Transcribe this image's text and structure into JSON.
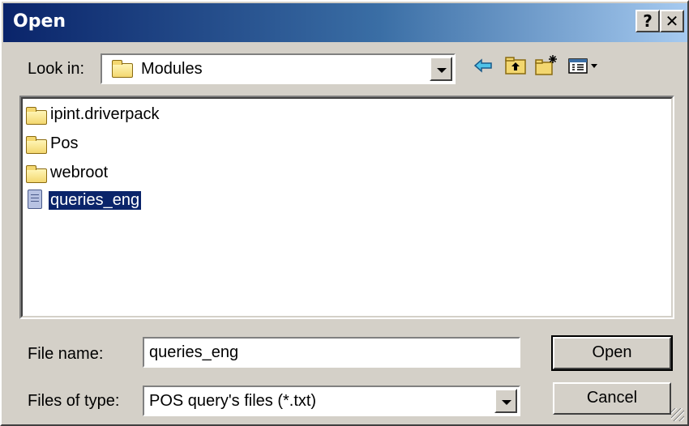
{
  "window": {
    "title": "Open",
    "help_label": "?",
    "close_label": "✕"
  },
  "look_in": {
    "label": "Look in:",
    "value": "Modules",
    "icon": "folder-icon"
  },
  "toolbar": {
    "back": "back-icon",
    "up_folder": "up-folder-icon",
    "new_folder": "new-folder-icon",
    "view_menu": "view-menu-icon"
  },
  "files": [
    {
      "name": "ipint.driverpack",
      "type": "folder",
      "selected": false
    },
    {
      "name": "Pos",
      "type": "folder",
      "selected": false
    },
    {
      "name": "webroot",
      "type": "folder",
      "selected": false
    },
    {
      "name": "queries_eng",
      "type": "file",
      "selected": true
    }
  ],
  "file_name": {
    "label": "File name:",
    "value": "queries_eng"
  },
  "file_type": {
    "label": "Files of type:",
    "value": "POS query's files (*.txt)"
  },
  "buttons": {
    "open": "Open",
    "cancel": "Cancel"
  },
  "colors": {
    "title_gradient_start": "#0a246a",
    "title_gradient_end": "#a6caf0",
    "selection": "#0a246a",
    "face": "#d4d0c8"
  }
}
